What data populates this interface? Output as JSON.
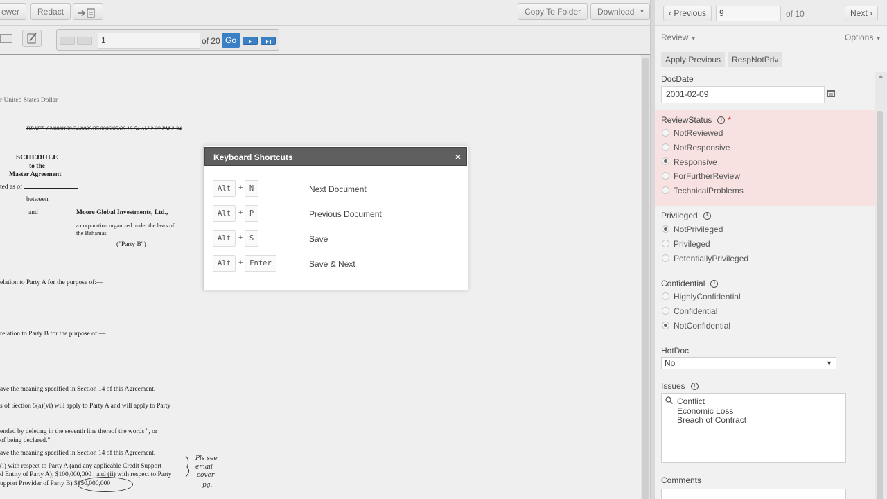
{
  "toolbar": {
    "viewer_label": "ewer",
    "redact_label": "Redact",
    "export_icon": "arrow-to-doc-icon",
    "copy_to_folder_label": "Copy To Folder",
    "download_label": "Download"
  },
  "pager": {
    "current_page": "1",
    "of_pages": "of 20",
    "go_label": "Go"
  },
  "document": {
    "line_currency": "r United States Dollar",
    "draft_line": "DRAFT: 02/08/0108/24/0006/07/0006/05/00 10:54 AM 2:22 PM 2:34",
    "schedule": "SCHEDULE",
    "to_the": "to the",
    "master_agreement": "Master Agreement",
    "dated_as_of": "ted as of",
    "between": "between",
    "and": "and",
    "party_b_name": "Moore Global Investments, Ltd.,",
    "corp_line1": "a corporation organized under the laws of",
    "corp_line2": "the Bahamas",
    "party_b": "(\"Party B\")",
    "relation_a": "elation to Party A for the purpose of:—",
    "relation_b": "relation to Party B for the purpose of:—",
    "meaning_line": "ave the meaning specified in Section 14 of this Agreement.",
    "section5_line": "s of Section 5(a)(vi) will apply to Party A and will apply to Party",
    "amended_line": "ended by deleting in the seventh line thereof the words \", or",
    "declared_line": "of being declared.\".",
    "meaning_line2": "ave the meaning specified in Section 14 of this Agreement.",
    "respect_a": "(i) with respect to Party A (and any applicable Credit Support",
    "entity_line": "d Entity of Party A), $100,000,000 , and (ii) with respect to Party",
    "support_line": "upport Provider of Party B) $150,000,000",
    "handwriting": "Pls see email cover pg."
  },
  "modal": {
    "title": "Keyboard Shortcuts",
    "close_icon": "close-icon",
    "shortcuts": [
      {
        "mod": "Alt",
        "key": "N",
        "action": "Next Document"
      },
      {
        "mod": "Alt",
        "key": "P",
        "action": "Previous Document"
      },
      {
        "mod": "Alt",
        "key": "S",
        "action": "Save"
      },
      {
        "mod": "Alt",
        "key": "Enter",
        "action": "Save & Next"
      }
    ]
  },
  "review_panel": {
    "previous_label": "Previous",
    "doc_number": "9",
    "of_docs": "of 10",
    "next_label": "Next",
    "review_menu": "Review",
    "options_menu": "Options",
    "apply_previous": "Apply Previous",
    "resp_not_priv": "RespNotPriv",
    "doc_date_label": "DocDate",
    "doc_date_value": "2001-02-09",
    "review_status_label": "ReviewStatus",
    "review_status_options": [
      "NotReviewed",
      "NotResponsive",
      "Responsive",
      "ForFurtherReview",
      "TechnicalProblems"
    ],
    "review_status_selected": "Responsive",
    "privileged_label": "Privileged",
    "privileged_options": [
      "NotPrivileged",
      "Privileged",
      "PotentiallyPrivileged"
    ],
    "privileged_selected": "NotPrivileged",
    "confidential_label": "Confidential",
    "confidential_options": [
      "HighlyConfidential",
      "Confidential",
      "NotConfidential"
    ],
    "confidential_selected": "NotConfidential",
    "hotdoc_label": "HotDoc",
    "hotdoc_value": "No",
    "issues_label": "Issues",
    "issues": [
      "Conflict",
      "Economic Loss",
      "Breach of Contract"
    ],
    "comments_label": "Comments"
  },
  "colors": {
    "accent_blue": "#3b7fc4",
    "required_red": "#d33333",
    "review_status_bg": "#f7e1e1",
    "modal_header": "#5f5f5f"
  }
}
